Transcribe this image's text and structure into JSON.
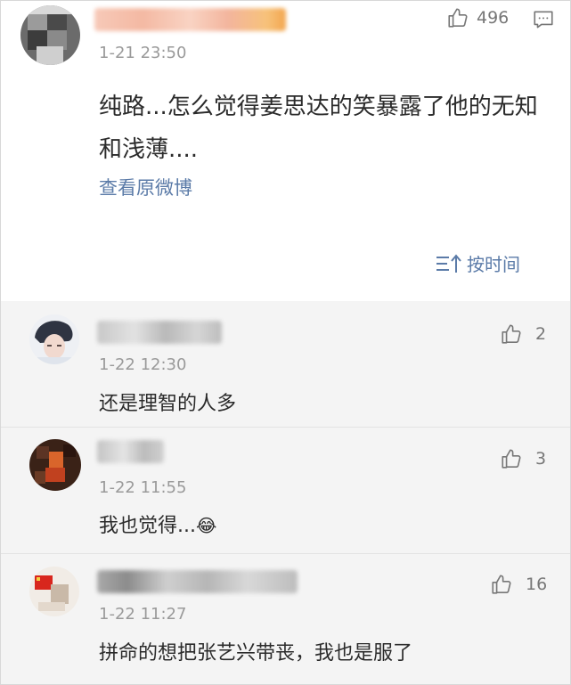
{
  "post": {
    "time": "1-21 23:50",
    "likes": "496",
    "text": "纯路...怎么觉得姜思达的笑暴露了他的无知和浅薄....",
    "view_original": "查看原微博",
    "sort_label": "按时间"
  },
  "replies": [
    {
      "time": "1-22 12:30",
      "likes": "2",
      "text": "还是理智的人多"
    },
    {
      "time": "1-22 11:55",
      "likes": "3",
      "text": "我也觉得...",
      "emoji": "😂"
    },
    {
      "time": "1-22 11:27",
      "likes": "16",
      "text": "拼命的想把张艺兴带丧，我也是服了"
    }
  ],
  "icons": {
    "like": "thumbs-up-icon",
    "comment": "comment-icon",
    "sort": "sort-icon"
  },
  "colors": {
    "link": "#5b7ba8",
    "reply_bg": "#f4f4f4",
    "meta_gray": "#9a9a9a"
  }
}
